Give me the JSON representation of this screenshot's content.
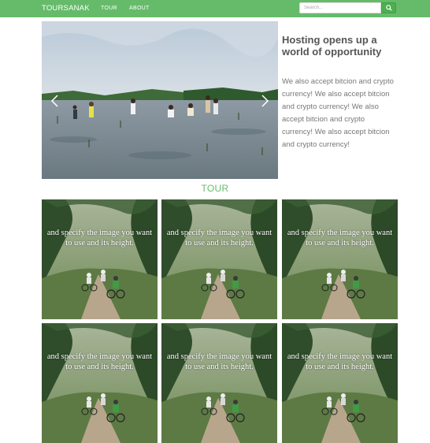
{
  "nav": {
    "brand": "TOURSANAK",
    "links": [
      "TOUR",
      "ABOUT"
    ],
    "search_placeholder": "Search...",
    "search_icon": "search-icon"
  },
  "hero": {
    "title": "Hosting opens up a world of opportunity",
    "text": "We also accept bitcion and crypto currency! We also accept bitcion and crypto currency! We also accept bitcion and crypto currency! We also accept bitcion and crypto currency!",
    "prev_icon": "chevron-left-icon",
    "next_icon": "chevron-right-icon"
  },
  "section": {
    "title": "TOUR"
  },
  "tiles": [
    {
      "caption": "and specify the image you want to use and its height."
    },
    {
      "caption": "and specify the image you want to use and its height."
    },
    {
      "caption": "and specify the image you want to use and its height."
    },
    {
      "caption": "and specify the image you want to use and its height."
    },
    {
      "caption": "and specify the image you want to use and its height."
    },
    {
      "caption": "and specify the image you want to use and its height."
    }
  ],
  "colors": {
    "accent": "#66bb6a",
    "button": "#4caf50"
  }
}
